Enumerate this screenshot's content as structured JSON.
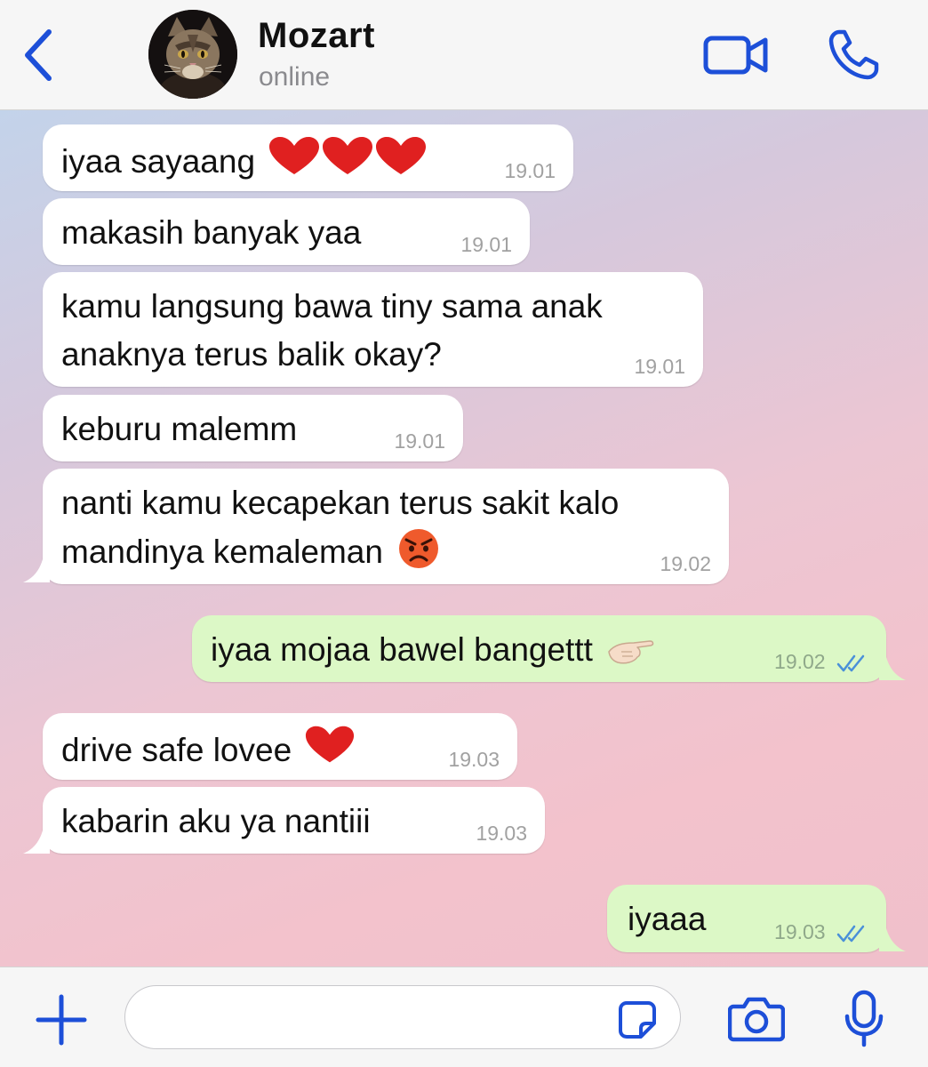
{
  "header": {
    "back_icon": "chevron-left-icon",
    "contact_name": "Mozart",
    "status": "online",
    "avatar_alt": "contact-avatar",
    "video_icon": "video-camera-icon",
    "call_icon": "phone-icon",
    "accent_color": "#1d4fd8"
  },
  "messages": [
    {
      "direction": "in",
      "text": "iyaa sayaang",
      "emoji": "❤️❤️❤️",
      "time": "19.01"
    },
    {
      "direction": "in",
      "text": "makasih banyak yaa",
      "time": "19.01"
    },
    {
      "direction": "in",
      "lines": [
        "kamu langsung bawa tiny sama anak",
        "anaknya terus balik okay?"
      ],
      "time": "19.01"
    },
    {
      "direction": "in",
      "text": "keburu malemm",
      "time": "19.01"
    },
    {
      "direction": "in",
      "lines": [
        "nanti kamu kecapekan terus sakit kalo",
        "mandinya kemaleman"
      ],
      "emoji": "😡",
      "time": "19.02"
    },
    {
      "direction": "out",
      "text": "iyaa mojaa bawel bangettt",
      "emoji": "🫲🏻",
      "time": "19.02",
      "read": true
    },
    {
      "direction": "in",
      "text": "drive safe lovee",
      "emoji": "❤️",
      "time": "19.03"
    },
    {
      "direction": "in",
      "text": "kabarin aku ya nantiii",
      "time": "19.03"
    },
    {
      "direction": "out",
      "text": "iyaaa",
      "time": "19.03",
      "read": true
    }
  ],
  "colors": {
    "incoming_bubble": "#ffffff",
    "outgoing_bubble": "#dcf8c6",
    "read_ticks": "#4a90d9",
    "icon_accent": "#1d4fd8"
  },
  "input_bar": {
    "plus_icon": "plus-icon",
    "message_value": "",
    "sticker_icon": "sticker-icon",
    "camera_icon": "camera-icon",
    "mic_icon": "microphone-icon"
  }
}
